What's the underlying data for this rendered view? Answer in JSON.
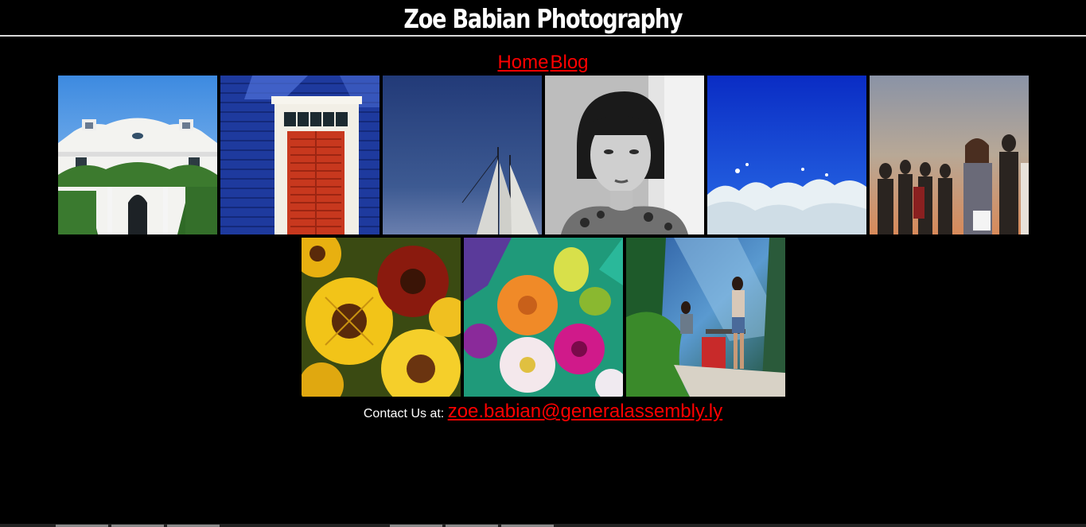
{
  "header": {
    "title": "Zoe Babian Photography"
  },
  "nav": {
    "home": "Home",
    "blog": "Blog"
  },
  "gallery": {
    "row1": [
      {
        "subject": "white-mansion-photo"
      },
      {
        "subject": "red-door-blue-wall-photo"
      },
      {
        "subject": "sailboat-dusk-photo"
      },
      {
        "subject": "bw-portrait-photo"
      },
      {
        "subject": "ocean-wave-photo"
      },
      {
        "subject": "crowd-sunset-photo"
      }
    ],
    "row2": [
      {
        "subject": "sunflowers-photo"
      },
      {
        "subject": "dahlia-bouquet-photo"
      },
      {
        "subject": "garden-table-photo"
      }
    ]
  },
  "contact": {
    "label": "Contact Us at:",
    "email": "zoe.babian@generalassembly.ly"
  },
  "colors": {
    "background": "#000000",
    "link": "#ff0000",
    "text": "#ffffff"
  }
}
